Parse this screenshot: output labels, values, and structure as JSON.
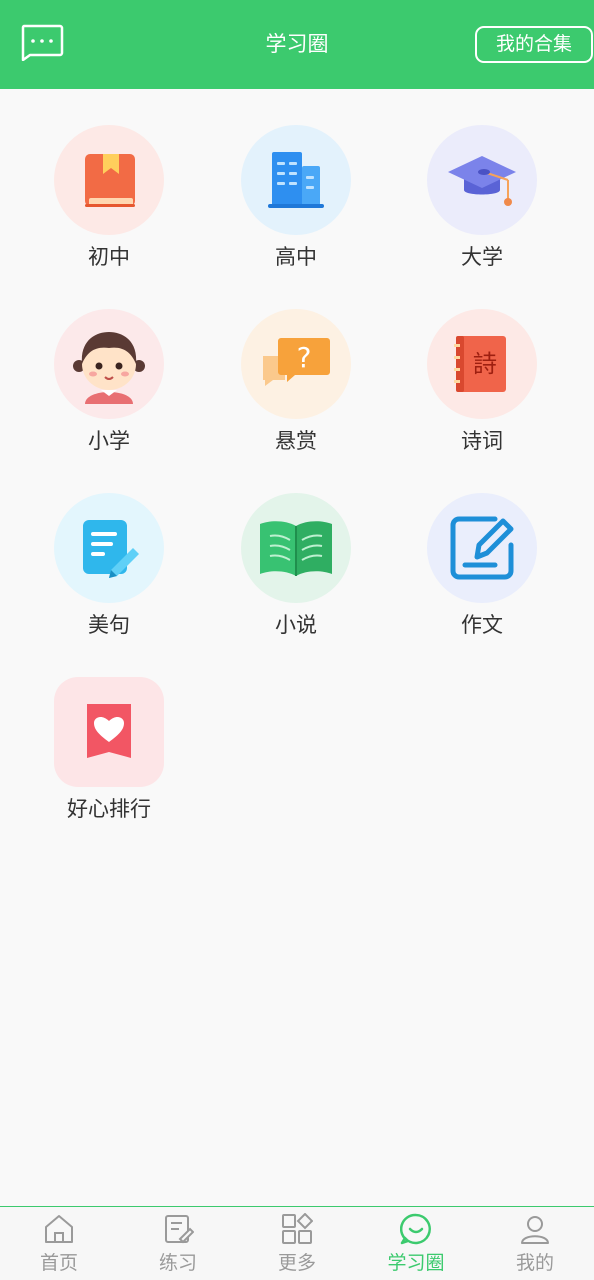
{
  "header": {
    "title": "学习圈",
    "collection_label": "我的合集"
  },
  "categories": [
    {
      "label": "初中",
      "icon": "book-icon",
      "bg": "#fde9e6"
    },
    {
      "label": "高中",
      "icon": "building-icon",
      "bg": "#e3f2fc"
    },
    {
      "label": "大学",
      "icon": "graduation-cap-icon",
      "bg": "#ebecfb"
    },
    {
      "label": "小学",
      "icon": "girl-icon",
      "bg": "#fce9ea"
    },
    {
      "label": "悬赏",
      "icon": "question-bubble-icon",
      "bg": "#fdf1e3"
    },
    {
      "label": "诗词",
      "icon": "poem-book-icon",
      "bg": "#fde9e6"
    },
    {
      "label": "美句",
      "icon": "note-pen-icon",
      "bg": "#e3f6fd"
    },
    {
      "label": "小说",
      "icon": "open-book-icon",
      "bg": "#e3f4ea"
    },
    {
      "label": "作文",
      "icon": "edit-icon",
      "bg": "#eaeefc"
    },
    {
      "label": "好心排行",
      "icon": "heart-badge-icon",
      "bg": "#fde5e7"
    }
  ],
  "tabs": [
    {
      "label": "首页",
      "icon": "home-icon",
      "active": false
    },
    {
      "label": "练习",
      "icon": "practice-icon",
      "active": false
    },
    {
      "label": "更多",
      "icon": "grid-icon",
      "active": false
    },
    {
      "label": "学习圈",
      "icon": "chat-circle-icon",
      "active": true
    },
    {
      "label": "我的",
      "icon": "user-icon",
      "active": false
    }
  ],
  "colors": {
    "brand": "#3cca6e",
    "tab_inactive": "#9a9a9a"
  }
}
